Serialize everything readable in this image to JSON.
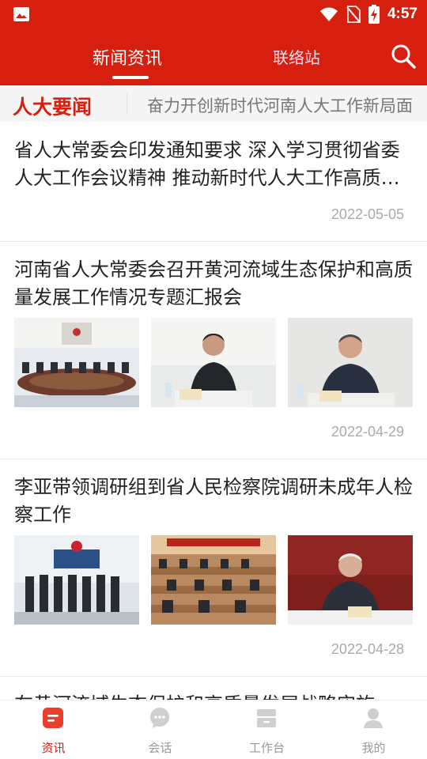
{
  "status_bar": {
    "time": "4:57",
    "icons": [
      "image-icon",
      "wifi-icon",
      "no-sim-icon",
      "battery-charging-icon"
    ]
  },
  "header": {
    "tabs": [
      {
        "label": "新闻资讯",
        "active": true
      },
      {
        "label": "联络站",
        "active": false
      }
    ],
    "search_icon": "search-icon"
  },
  "ticker": {
    "label": "人大要闻",
    "text": "奋力开创新时代河南人大工作新局面"
  },
  "news": [
    {
      "title": "省人大常委会印发通知要求 深入学习贯彻省委人大工作会议精神 推动新时代人大工作高质量发展",
      "date": "2022-05-05",
      "has_images": false
    },
    {
      "title": "河南省人大常委会召开黄河流域生态保护和高质量发展工作情况专题汇报会",
      "date": "2022-04-29",
      "has_images": true
    },
    {
      "title": "李亚带领调研组到省人民检察院调研未成年人检察工作",
      "date": "2022-04-28",
      "has_images": true
    },
    {
      "title": "在黄河流域生态保护和高质量发展战略实施",
      "date": "",
      "has_images": false
    }
  ],
  "tabbar": {
    "items": [
      {
        "label": "资讯",
        "icon": "news-icon",
        "active": true
      },
      {
        "label": "会话",
        "icon": "chat-icon",
        "active": false
      },
      {
        "label": "工作台",
        "icon": "workbench-icon",
        "active": false
      },
      {
        "label": "我的",
        "icon": "profile-icon",
        "active": false
      }
    ]
  },
  "colors": {
    "brand_red": "#d71f0f",
    "text_dark": "#222222",
    "text_gray": "#aaaaaa"
  }
}
